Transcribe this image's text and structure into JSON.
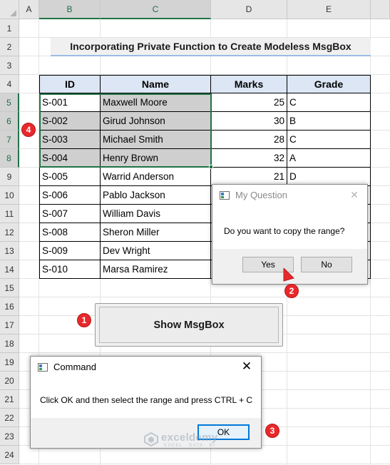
{
  "columns": [
    "A",
    "B",
    "C",
    "D",
    "E"
  ],
  "rows": [
    "1",
    "2",
    "3",
    "4",
    "5",
    "6",
    "7",
    "8",
    "9",
    "10",
    "11",
    "12",
    "13",
    "14",
    "15",
    "16",
    "17",
    "18",
    "19",
    "20",
    "21",
    "22",
    "23",
    "24"
  ],
  "title": "Incorporating Private Function to Create Modeless MsgBox",
  "table": {
    "headers": [
      "ID",
      "Name",
      "Marks",
      "Grade"
    ],
    "rows": [
      [
        "S-001",
        "Maxwell Moore",
        "25",
        "C"
      ],
      [
        "S-002",
        "Girud Johnson",
        "30",
        "B"
      ],
      [
        "S-003",
        "Michael Smith",
        "28",
        "C"
      ],
      [
        "S-004",
        "Henry Brown",
        "32",
        "A"
      ],
      [
        "S-005",
        "Warrid Anderson",
        "21",
        "D"
      ],
      [
        "S-006",
        "Pablo Jackson",
        "",
        ""
      ],
      [
        "S-007",
        "William Davis",
        "",
        ""
      ],
      [
        "S-008",
        "Sheron Miller",
        "",
        ""
      ],
      [
        "S-009",
        "Dev Wright",
        "",
        ""
      ],
      [
        "S-010",
        "Marsa Ramirez",
        "",
        ""
      ]
    ]
  },
  "show_button": {
    "label": "Show MsgBox"
  },
  "question_dialog": {
    "title": "My Question",
    "message": "Do you want to copy the range?",
    "yes_label": "Yes",
    "no_label": "No",
    "close_glyph": "✕"
  },
  "command_dialog": {
    "title": "Command",
    "message": "Click OK and then select the range and press CTRL + C",
    "ok_label": "OK",
    "close_glyph": "✕"
  },
  "badges": {
    "one": "1",
    "two": "2",
    "three": "3",
    "four": "4"
  },
  "watermark": {
    "name": "exceldemy",
    "tagline": "EXCEL · DATA · BI"
  },
  "colors": {
    "header_fill": "#dce6f4",
    "selection": "#217346",
    "badge": "#e8282b",
    "focus": "#0078d7"
  }
}
